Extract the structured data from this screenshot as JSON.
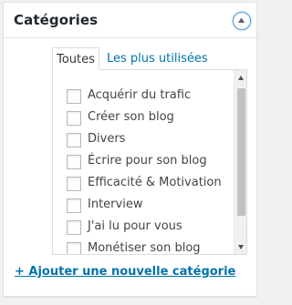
{
  "panel": {
    "title": "Catégories",
    "toggle_icon": "arrow-up-circle-icon"
  },
  "tabs": {
    "all_label": "Toutes",
    "popular_label": "Les plus utilisées"
  },
  "categories": [
    {
      "label": "Acquérir du trafic",
      "checked": false
    },
    {
      "label": "Créer son blog",
      "checked": false
    },
    {
      "label": "Divers",
      "checked": false
    },
    {
      "label": "Écrire pour son blog",
      "checked": false
    },
    {
      "label": "Efficacité & Motivation",
      "checked": false
    },
    {
      "label": "Interview",
      "checked": false
    },
    {
      "label": "J'ai lu pour vous",
      "checked": false
    },
    {
      "label": "Monétiser son blog",
      "checked": false
    }
  ],
  "add_category_label": "+ Ajouter une nouvelle catégorie",
  "colors": {
    "link": "#0073aa",
    "title": "#23282d",
    "text": "#444444",
    "border": "#dddddd",
    "toggle_ring": "#5b9dd9"
  }
}
